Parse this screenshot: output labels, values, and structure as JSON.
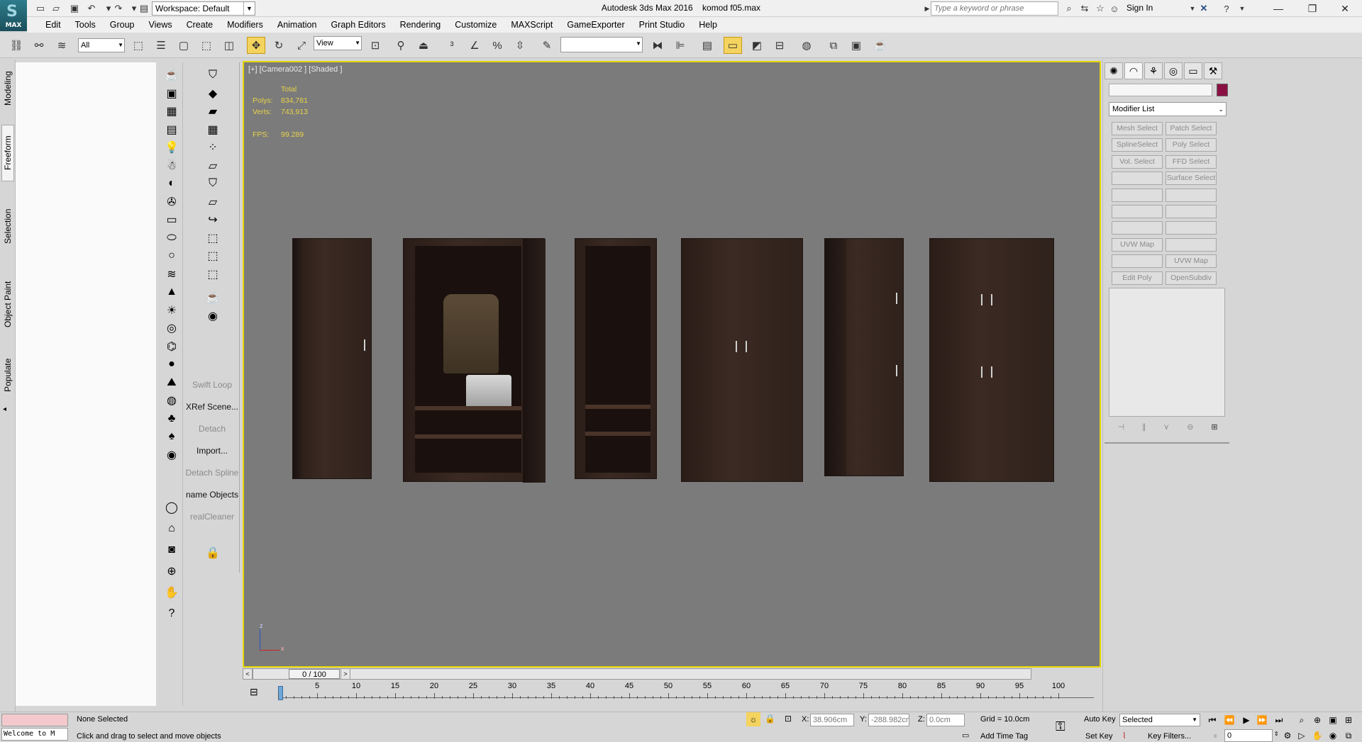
{
  "app": {
    "title": "Autodesk 3ds Max 2016",
    "file": "komod f05.max",
    "logo_text": "MAX",
    "workspace": "Workspace: Default",
    "search_placeholder": "Type a keyword or phrase",
    "sign_in": "Sign In"
  },
  "menu": [
    "Edit",
    "Tools",
    "Group",
    "Views",
    "Create",
    "Modifiers",
    "Animation",
    "Graph Editors",
    "Rendering",
    "Customize",
    "MAXScript",
    "GameExporter",
    "Print Studio",
    "Help"
  ],
  "toolbar": {
    "selection_filter": "All",
    "reference_coord": "View",
    "named_selection": ""
  },
  "ribbon_tabs": [
    "Modeling",
    "Freeform",
    "Selection",
    "Object Paint",
    "Populate"
  ],
  "ribbon_selected": "Freeform",
  "command_labels": [
    {
      "text": "Swift Loop",
      "disabled": true
    },
    {
      "text": "XRef Scene...",
      "disabled": false
    },
    {
      "text": "Detach",
      "disabled": true
    },
    {
      "text": "Import...",
      "disabled": false
    },
    {
      "text": "Detach Spline",
      "disabled": true
    },
    {
      "text": "name Objects",
      "disabled": false
    },
    {
      "text": "realCleaner",
      "disabled": true
    }
  ],
  "viewport": {
    "label": "[+] [Camera002 ] [Shaded ]",
    "stats_header": "Total",
    "polys_label": "Polys:",
    "polys": "834,781",
    "verts_label": "Verts:",
    "verts": "743,913",
    "fps_label": "FPS:",
    "fps": "99.289",
    "axis_z": "z",
    "axis_x": "x"
  },
  "time": {
    "slider": "0 / 100",
    "ticks": [
      5,
      10,
      15,
      20,
      25,
      30,
      35,
      40,
      45,
      50,
      55,
      60,
      65,
      70,
      75,
      80,
      85,
      90,
      95,
      100
    ]
  },
  "modify_panel": {
    "modifier_list": "Modifier List",
    "buttons": [
      [
        "Mesh Select",
        "Patch Select"
      ],
      [
        "SplineSelect",
        "Poly Select"
      ],
      [
        "Vol. Select",
        "FFD Select"
      ],
      [
        "",
        "Surface Select"
      ],
      [
        "",
        ""
      ],
      [
        "",
        ""
      ],
      [
        "",
        ""
      ],
      [
        "UVW Map",
        ""
      ],
      [
        "",
        "UVW Map"
      ],
      [
        "Edit Poly",
        "OpenSubdiv"
      ]
    ],
    "color": "#8a1044"
  },
  "status": {
    "maxscript": "Welcome to M",
    "selection": "None Selected",
    "prompt": "Click and drag to select and move objects",
    "x_label": "X:",
    "x": "38.906cm",
    "y_label": "Y:",
    "y": "-288.982cm",
    "z_label": "Z:",
    "z": "0.0cm",
    "grid": "Grid = 10.0cm",
    "add_time_tag": "Add Time Tag",
    "auto_key": "Auto Key",
    "set_key": "Set Key",
    "key_mode": "Selected",
    "key_filters": "Key Filters...",
    "frame": "0"
  }
}
